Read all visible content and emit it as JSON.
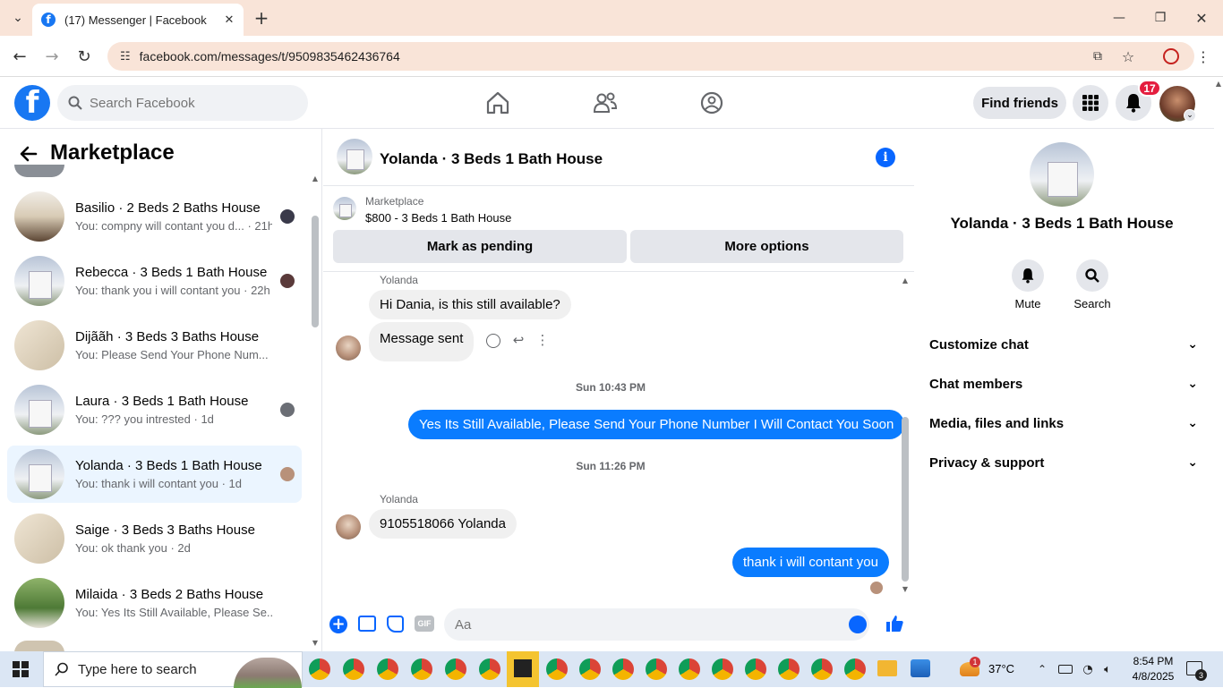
{
  "browser": {
    "tab_title": "(17) Messenger | Facebook",
    "url": "facebook.com/messages/t/9509835462436764"
  },
  "fb_header": {
    "search_placeholder": "Search Facebook",
    "find_friends": "Find friends",
    "notif_count": "17"
  },
  "left_panel": {
    "title": "Marketplace",
    "conversations": [
      {
        "name": "Basilio · 2 Beds 2 Baths House",
        "preview": "You: compny will contant you d... · 21h",
        "thumb": "room2"
      },
      {
        "name": "Rebecca · 3 Beds 1 Bath House",
        "preview": "You: thank you i will contant you · 22h",
        "thumb": "house"
      },
      {
        "name": "Dijããh · 3 Beds 3 Baths House",
        "preview": "You: Please Send Your Phone Num... · 1d",
        "thumb": "room"
      },
      {
        "name": "Laura · 3 Beds 1 Bath House",
        "preview": "You: ??? you intrested · 1d",
        "thumb": "house"
      },
      {
        "name": "Yolanda · 3 Beds 1 Bath House",
        "preview": "You: thank i will contant you · 1d",
        "thumb": "house",
        "active": true
      },
      {
        "name": "Saige · 3 Beds 3 Baths House",
        "preview": "You: ok thank you · 2d",
        "thumb": "room"
      },
      {
        "name": "Milaida · 3 Beds 2 Baths House",
        "preview": "You: Yes Its Still Available, Please Se... · 2d",
        "thumb": "yard"
      }
    ]
  },
  "chat": {
    "title": "Yolanda · 3 Beds 1 Bath House",
    "marketplace_label": "Marketplace",
    "listing": "$800 - 3 Beds 1 Bath House",
    "mark_pending": "Mark as pending",
    "more_options": "More options",
    "sender_name": "Yolanda",
    "msg1": "Hi Dania, is this still available?",
    "msg2": "Message sent",
    "ts1": "Sun 10:43 PM",
    "out1": "Yes Its Still Available, Please Send Your Phone Number I Will Contact You Soon",
    "ts2": "Sun 11:26 PM",
    "sender_name2": "Yolanda",
    "msg3": "9105518066 Yolanda",
    "out2": "thank i will contant you",
    "composer_placeholder": "Aa",
    "gif_label": "GIF"
  },
  "right_panel": {
    "name": "Yolanda · 3 Beds 1 Bath House",
    "mute": "Mute",
    "search": "Search",
    "rows": [
      "Customize chat",
      "Chat members",
      "Media, files and links",
      "Privacy & support"
    ]
  },
  "taskbar": {
    "search_placeholder": "Type here to search",
    "temperature": "37°C",
    "time": "8:54 PM",
    "date": "4/8/2025",
    "notif_count": "3",
    "weather_badge": "1"
  },
  "colors": {
    "fb_blue": "#1877f2",
    "messenger_blue": "#0a7cff",
    "active_row": "#ebf5ff"
  }
}
